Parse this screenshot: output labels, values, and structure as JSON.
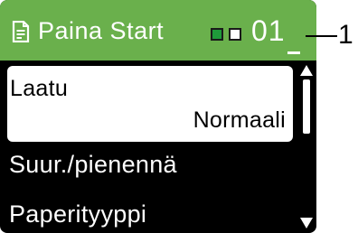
{
  "header": {
    "title": "Paina Start",
    "counter": "01",
    "icon": "document-icon",
    "color": "#6ab04c"
  },
  "callout": {
    "label": "1"
  },
  "menu": {
    "items": [
      {
        "label": "Laatu",
        "value": "Normaali",
        "selected": true
      },
      {
        "label": "Suur./pienennä"
      },
      {
        "label": "Paperityyppi"
      }
    ]
  },
  "indicators": [
    {
      "name": "green-square-indicator",
      "color": "#1f9a3a"
    },
    {
      "name": "white-square-indicator",
      "color": "#ffffff"
    }
  ]
}
